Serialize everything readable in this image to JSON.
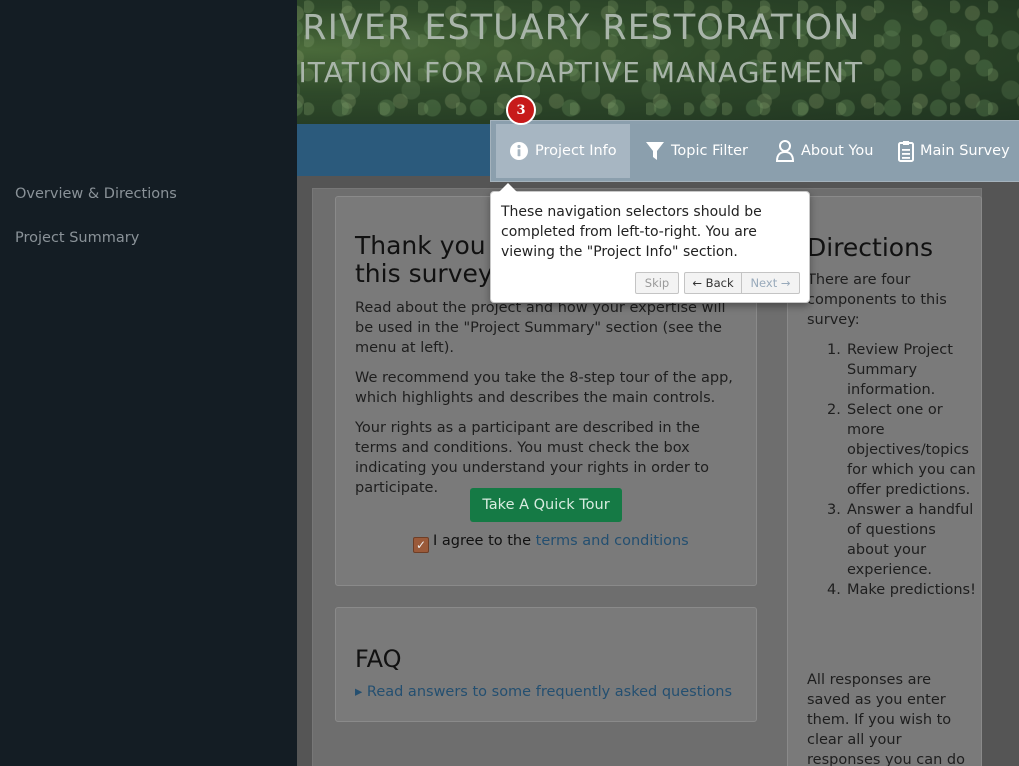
{
  "banner": {
    "title": "G RIVER ESTUARY RESTORATION",
    "subtitle": "CITATION FOR ADAPTIVE MANAGEMENT"
  },
  "sidebar": {
    "items": [
      {
        "label": "Overview & Directions"
      },
      {
        "label": "Project Summary"
      }
    ]
  },
  "nav": {
    "tabs": [
      {
        "label": "Project Info",
        "icon": "info-circle-icon",
        "active": true
      },
      {
        "label": "Topic Filter",
        "icon": "filter-icon"
      },
      {
        "label": "About You",
        "icon": "user-icon"
      },
      {
        "label": "Main Survey",
        "icon": "clipboard-icon"
      }
    ]
  },
  "tour": {
    "step": "3",
    "text": "These navigation selectors should be completed from left-to-right. You are viewing the \"Project Info\" section.",
    "skip": "Skip",
    "back": "← Back",
    "next": "Next →"
  },
  "intro": {
    "heading": "Thank you for taking this survey",
    "heading_visible_1": "Thank you",
    "heading_visible_2": "this survey",
    "p1": "Read about the project and how your expertise will be used in the \"Project Summary\" section (see the menu at left).",
    "p2": "We recommend you take the 8-step tour of the app, which highlights and describes the main controls.",
    "p3": "Your rights as a participant are described in the terms and conditions. You must check the box indicating you understand your rights in order to participate.",
    "tour_button": "Take A Quick Tour",
    "agree_prefix": "I agree to the",
    "agree_link": "terms and conditions",
    "agree_checked": true
  },
  "faq": {
    "heading": "FAQ",
    "link": "Read answers to some frequently asked questions"
  },
  "directions": {
    "heading": "Directions",
    "intro": "There are four components to this survey:",
    "steps": [
      {
        "num": "1.",
        "text": "Review Project Summary information."
      },
      {
        "num": "2.",
        "text": "Select one or more objectives/topics for which you can offer predictions."
      },
      {
        "num": "3.",
        "text": "Answer a handful of questions about your experience."
      },
      {
        "num": "4.",
        "text": "Make predictions!"
      }
    ],
    "outro": "All responses are saved as you enter them. If you wish to clear all your responses you can do"
  },
  "colors": {
    "navbar": "#2b5a7c",
    "sidebar": "#141d24",
    "tour_badge": "#c71a1a",
    "tour_button": "#157a45"
  }
}
